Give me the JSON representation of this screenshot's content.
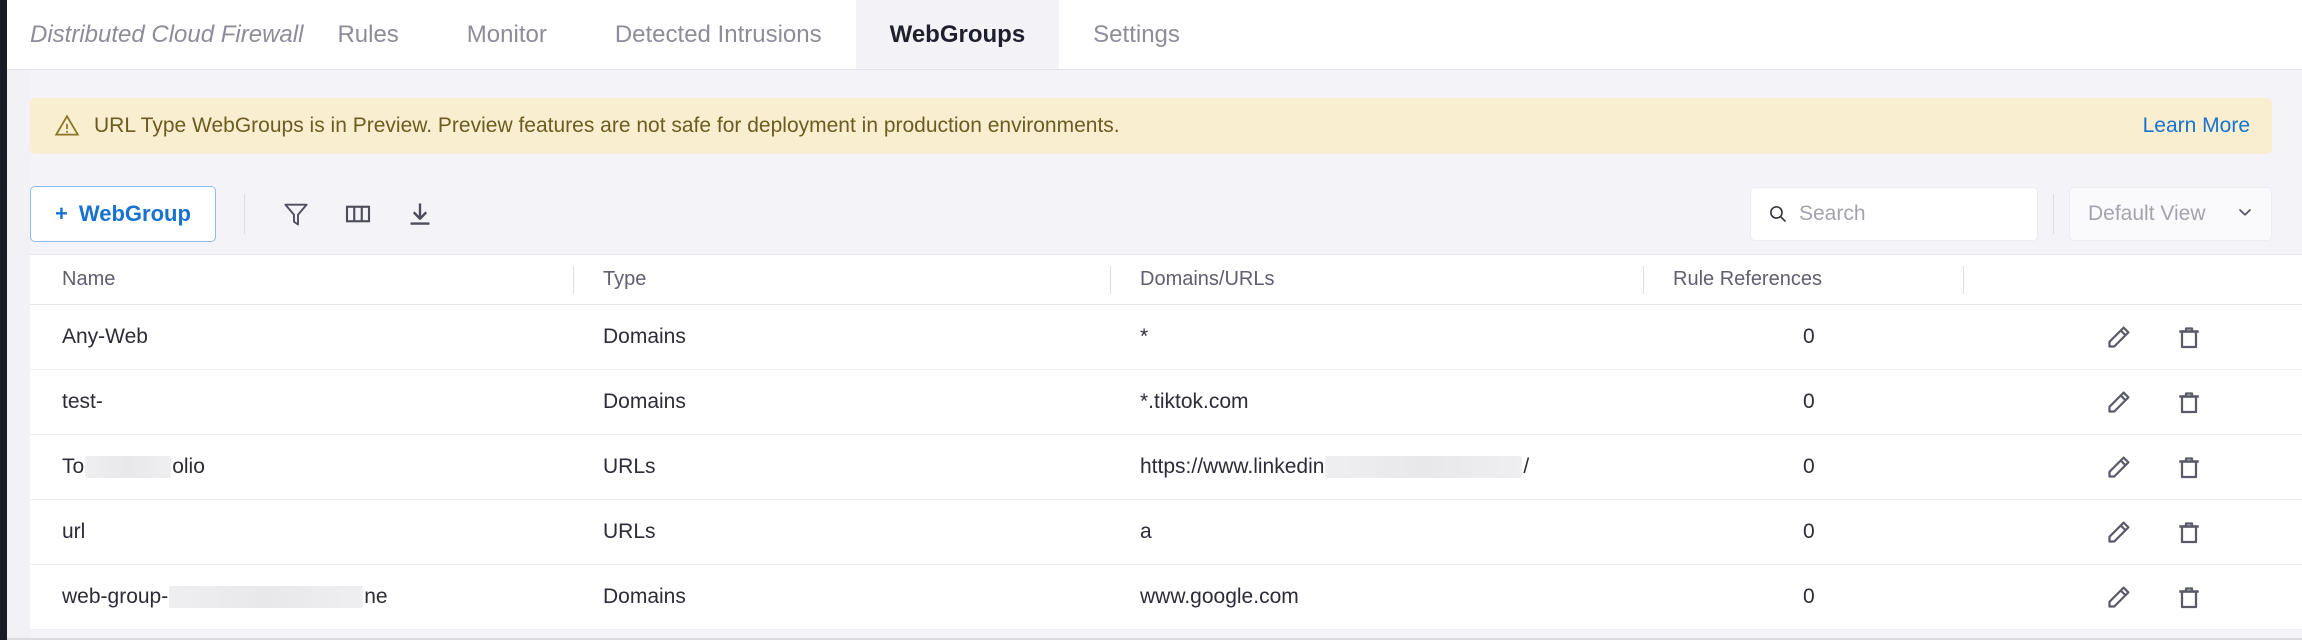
{
  "tabs": {
    "product_label": "Distributed Cloud Firewall",
    "items": [
      {
        "label": "Rules",
        "active": false
      },
      {
        "label": "Monitor",
        "active": false
      },
      {
        "label": "Detected Intrusions",
        "active": false
      },
      {
        "label": "WebGroups",
        "active": true
      },
      {
        "label": "Settings",
        "active": false
      }
    ]
  },
  "banner": {
    "icon": "warning-triangle-icon",
    "text": "URL Type WebGroups is in Preview. Preview features are not safe for deployment in production environments.",
    "link_label": "Learn More",
    "background_color": "#faeed1",
    "text_color": "#6b5c1f",
    "link_color": "#1872d0"
  },
  "toolbar": {
    "add_button_label": "WebGroup",
    "add_button_plus": "+",
    "add_button_color": "#1872d0",
    "icons": [
      {
        "name": "filter-icon"
      },
      {
        "name": "columns-icon"
      },
      {
        "name": "download-icon"
      }
    ],
    "search": {
      "placeholder": "Search",
      "value": "",
      "icon": "search-icon"
    },
    "view_select": {
      "selected": "Default View",
      "chevron": "chevron-down-icon"
    }
  },
  "table": {
    "columns": [
      "Name",
      "Type",
      "Domains/URLs",
      "Rule References",
      ""
    ],
    "rows": [
      {
        "name": "Any-Web",
        "name_redacted": false,
        "type": "Domains",
        "domain": "*",
        "domain_redacted": false,
        "rule_references": "0"
      },
      {
        "name": "test-",
        "name_redacted": false,
        "type": "Domains",
        "domain": "*.tiktok.com",
        "domain_redacted": false,
        "rule_references": "0"
      },
      {
        "name_prefix": "To",
        "name_suffix": "olio",
        "name_redacted": true,
        "redact_width": 86,
        "type": "URLs",
        "domain_prefix": "https://www.linkedin",
        "domain_suffix": "/",
        "domain_redacted": true,
        "domain_redact_width": 197,
        "rule_references": "0"
      },
      {
        "name": "url",
        "name_redacted": false,
        "type": "URLs",
        "domain": "a",
        "domain_redacted": false,
        "rule_references": "0"
      },
      {
        "name_prefix": "web-group-",
        "name_suffix": "ne",
        "name_redacted": true,
        "redact_width": 194,
        "type": "Domains",
        "domain": "www.google.com",
        "domain_redacted": false,
        "rule_references": "0"
      }
    ],
    "row_actions": [
      {
        "name": "edit-icon"
      },
      {
        "name": "delete-icon"
      }
    ]
  }
}
